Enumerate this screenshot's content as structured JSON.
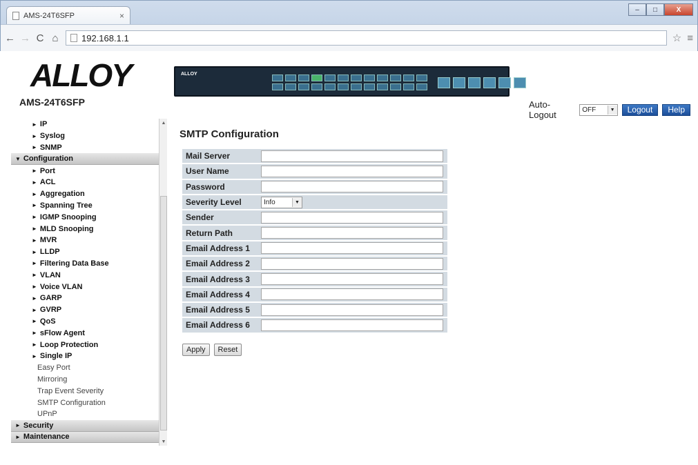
{
  "browser": {
    "tab_title": "AMS-24T6SFP",
    "tab_close": "×",
    "url": "192.168.1.1",
    "window_controls": [
      "–",
      "□",
      "X"
    ]
  },
  "header": {
    "logo": "ALLOY",
    "model": "AMS-24T6SFP",
    "autologout_label": "Auto-Logout",
    "autologout_value": "OFF",
    "logout_label": "Logout",
    "help_label": "Help"
  },
  "sidebar": {
    "items": [
      {
        "label": "IP",
        "level": 2,
        "caret": "►"
      },
      {
        "label": "Syslog",
        "level": 2,
        "caret": "►"
      },
      {
        "label": "SNMP",
        "level": 2,
        "caret": "►"
      },
      {
        "label": "Configuration",
        "level": 1,
        "caret": "▼"
      },
      {
        "label": "Port",
        "level": 2,
        "caret": "►"
      },
      {
        "label": "ACL",
        "level": 2,
        "caret": "►"
      },
      {
        "label": "Aggregation",
        "level": 2,
        "caret": "►"
      },
      {
        "label": "Spanning Tree",
        "level": 2,
        "caret": "►"
      },
      {
        "label": "IGMP Snooping",
        "level": 2,
        "caret": "►"
      },
      {
        "label": "MLD Snooping",
        "level": 2,
        "caret": "►"
      },
      {
        "label": "MVR",
        "level": 2,
        "caret": "►"
      },
      {
        "label": "LLDP",
        "level": 2,
        "caret": "►"
      },
      {
        "label": "Filtering Data Base",
        "level": 2,
        "caret": "►"
      },
      {
        "label": "VLAN",
        "level": 2,
        "caret": "►"
      },
      {
        "label": "Voice VLAN",
        "level": 2,
        "caret": "►"
      },
      {
        "label": "GARP",
        "level": 2,
        "caret": "►"
      },
      {
        "label": "GVRP",
        "level": 2,
        "caret": "►"
      },
      {
        "label": "QoS",
        "level": 2,
        "caret": "►"
      },
      {
        "label": "sFlow Agent",
        "level": 2,
        "caret": "►"
      },
      {
        "label": "Loop Protection",
        "level": 2,
        "caret": "►"
      },
      {
        "label": "Single IP",
        "level": 2,
        "caret": "►"
      },
      {
        "label": "Easy Port",
        "level": 3,
        "caret": ""
      },
      {
        "label": "Mirroring",
        "level": 3,
        "caret": ""
      },
      {
        "label": "Trap Event Severity",
        "level": 3,
        "caret": ""
      },
      {
        "label": "SMTP Configuration",
        "level": 3,
        "caret": ""
      },
      {
        "label": "UPnP",
        "level": 3,
        "caret": ""
      },
      {
        "label": "Security",
        "level": 1,
        "caret": "►"
      },
      {
        "label": "Maintenance",
        "level": 1,
        "caret": "►"
      }
    ]
  },
  "main": {
    "title": "SMTP Configuration",
    "fields": [
      {
        "label": "Mail Server",
        "type": "text",
        "value": ""
      },
      {
        "label": "User Name",
        "type": "text",
        "value": ""
      },
      {
        "label": "Password",
        "type": "text",
        "value": ""
      },
      {
        "label": "Severity Level",
        "type": "select",
        "value": "Info"
      },
      {
        "label": "Sender",
        "type": "text",
        "value": ""
      },
      {
        "label": "Return Path",
        "type": "text",
        "value": ""
      },
      {
        "label": "Email Address 1",
        "type": "text",
        "value": ""
      },
      {
        "label": "Email Address 2",
        "type": "text",
        "value": ""
      },
      {
        "label": "Email Address 3",
        "type": "text",
        "value": ""
      },
      {
        "label": "Email Address 4",
        "type": "text",
        "value": ""
      },
      {
        "label": "Email Address 5",
        "type": "text",
        "value": ""
      },
      {
        "label": "Email Address 6",
        "type": "text",
        "value": ""
      }
    ],
    "apply_label": "Apply",
    "reset_label": "Reset"
  },
  "colors": {
    "header_button": "#1d4f9a",
    "field_row_bg": "#d3dbe2",
    "sidebar_top_bg": "#c5c5c5"
  }
}
